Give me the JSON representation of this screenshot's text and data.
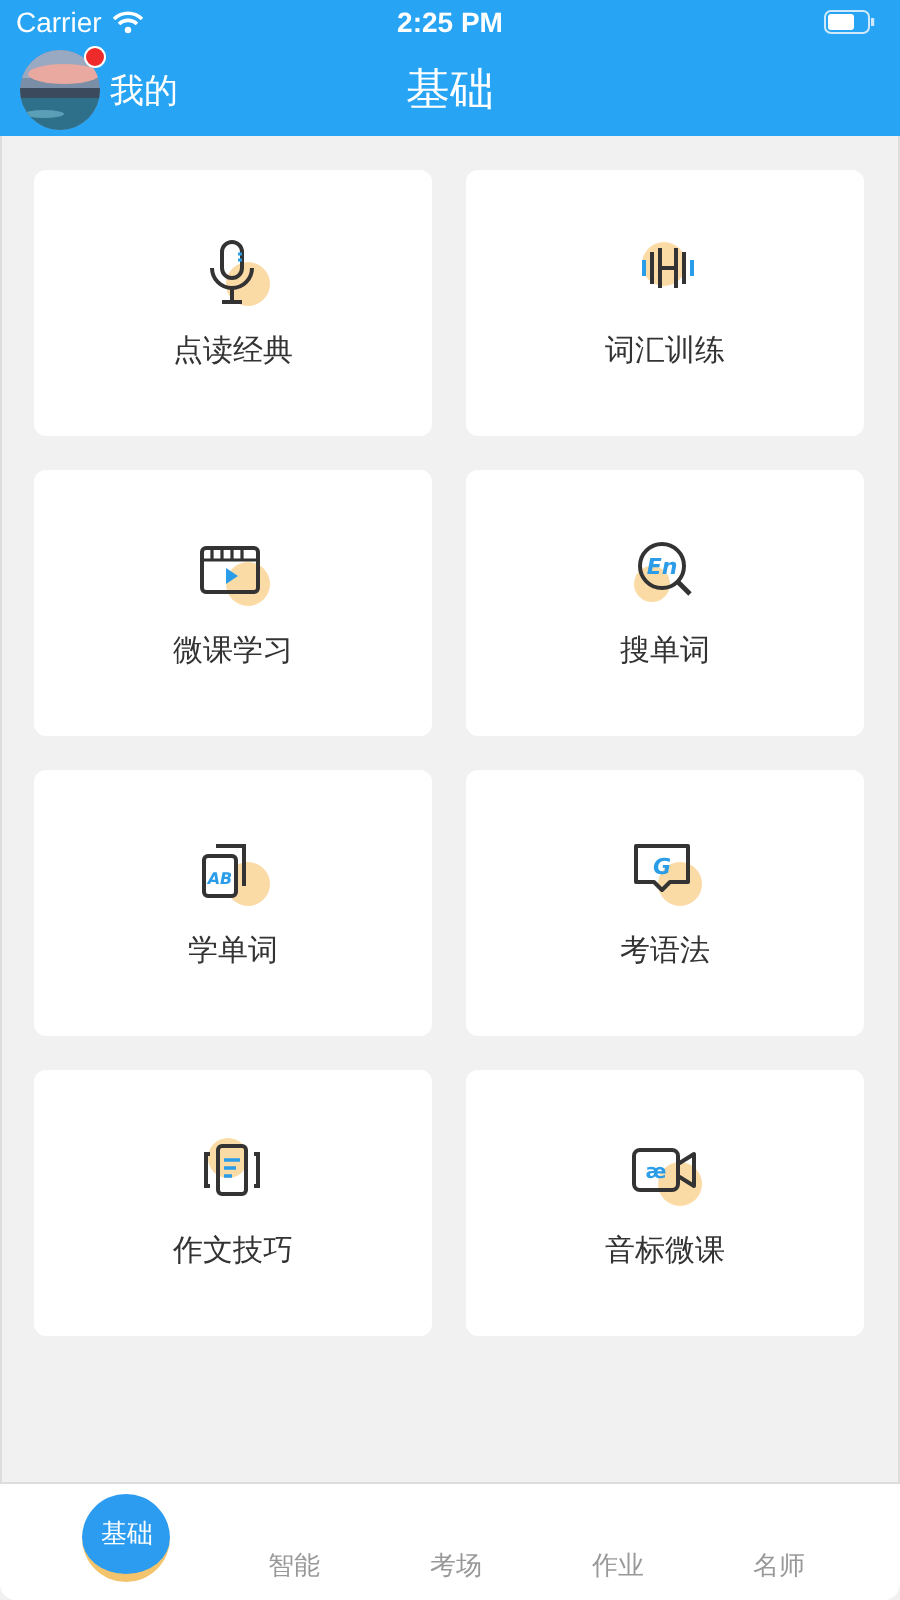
{
  "status_bar": {
    "carrier": "Carrier",
    "time": "2:25 PM"
  },
  "nav": {
    "profile_label": "我的",
    "has_notification": true,
    "title": "基础"
  },
  "card_rows": [
    {
      "cards": [
        {
          "label": "点读经典"
        },
        {
          "label": "词汇训练"
        }
      ]
    },
    {
      "cards": [
        {
          "label": "微课学习"
        },
        {
          "label": "搜单词",
          "icon_text": "En"
        }
      ]
    },
    {
      "cards": [
        {
          "label": "学单词",
          "icon_text": "AB"
        },
        {
          "label": "考语法",
          "icon_text": "G"
        }
      ]
    },
    {
      "cards": [
        {
          "label": "作文技巧"
        },
        {
          "label": "音标微课",
          "icon_text": "æ"
        }
      ]
    }
  ],
  "tab_bar": [
    {
      "label": "基础",
      "selected": true
    },
    {
      "label": "智能",
      "selected": false
    },
    {
      "label": "考场",
      "selected": false
    },
    {
      "label": "作业",
      "selected": false
    },
    {
      "label": "名师",
      "selected": false
    }
  ]
}
